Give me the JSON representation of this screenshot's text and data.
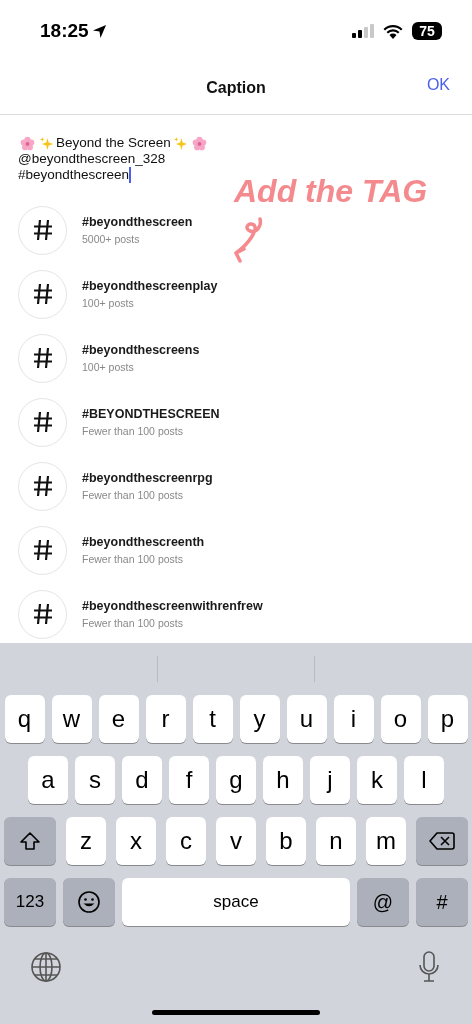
{
  "status_bar": {
    "time": "18:25",
    "battery": "75"
  },
  "header": {
    "title": "Caption",
    "action": "OK"
  },
  "caption": {
    "first_line": {
      "before": [
        {
          "kind": "flower"
        },
        {
          "kind": "sparkles"
        }
      ],
      "text": "Beyond the Screen",
      "after": [
        {
          "kind": "sparkles"
        },
        {
          "kind": "flower"
        }
      ]
    },
    "lines": [
      "@beyondthescreen_328",
      "#beyondthescreen"
    ]
  },
  "annotation": {
    "text": "Add the TAG"
  },
  "hashtags": [
    {
      "tag": "#beyondthescreen",
      "posts": "5000+ posts"
    },
    {
      "tag": "#beyondthescreenplay",
      "posts": "100+ posts"
    },
    {
      "tag": "#beyondthescreens",
      "posts": "100+ posts"
    },
    {
      "tag": "#BEYONDTHESCREEN",
      "posts": "Fewer than 100 posts"
    },
    {
      "tag": "#beyondthescreenrpg",
      "posts": "Fewer than 100 posts"
    },
    {
      "tag": "#beyondthescreenth",
      "posts": "Fewer than 100 posts"
    },
    {
      "tag": "#beyondthescreenwithrenfrew",
      "posts": "Fewer than 100 posts"
    }
  ],
  "keyboard": {
    "rows": [
      {
        "keys": [
          {
            "kind": "letter",
            "label": "q"
          },
          {
            "kind": "letter",
            "label": "w"
          },
          {
            "kind": "letter",
            "label": "e"
          },
          {
            "kind": "letter",
            "label": "r"
          },
          {
            "kind": "letter",
            "label": "t"
          },
          {
            "kind": "letter",
            "label": "y"
          },
          {
            "kind": "letter",
            "label": "u"
          },
          {
            "kind": "letter",
            "label": "i"
          },
          {
            "kind": "letter",
            "label": "o"
          },
          {
            "kind": "letter",
            "label": "p"
          }
        ]
      },
      {
        "keys": [
          {
            "kind": "letter",
            "label": "a"
          },
          {
            "kind": "letter",
            "label": "s"
          },
          {
            "kind": "letter",
            "label": "d"
          },
          {
            "kind": "letter",
            "label": "f"
          },
          {
            "kind": "letter",
            "label": "g"
          },
          {
            "kind": "letter",
            "label": "h"
          },
          {
            "kind": "letter",
            "label": "j"
          },
          {
            "kind": "letter",
            "label": "k"
          },
          {
            "kind": "letter",
            "label": "l"
          }
        ]
      },
      {
        "keys": [
          {
            "kind": "shift"
          },
          {
            "kind": "letter",
            "label": "z"
          },
          {
            "kind": "letter",
            "label": "x"
          },
          {
            "kind": "letter",
            "label": "c"
          },
          {
            "kind": "letter",
            "label": "v"
          },
          {
            "kind": "letter",
            "label": "b"
          },
          {
            "kind": "letter",
            "label": "n"
          },
          {
            "kind": "letter",
            "label": "m"
          },
          {
            "kind": "delete"
          }
        ]
      },
      {
        "keys": [
          {
            "kind": "mode",
            "label": "123"
          },
          {
            "kind": "emoji"
          },
          {
            "kind": "space",
            "label": "space"
          },
          {
            "kind": "symbol",
            "label": "@"
          },
          {
            "kind": "symbol",
            "label": "#"
          }
        ]
      }
    ]
  }
}
